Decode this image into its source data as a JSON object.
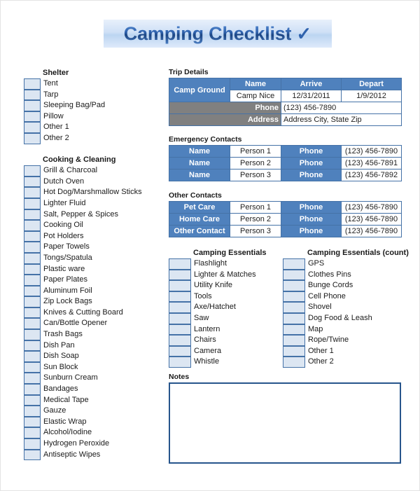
{
  "title": {
    "text": "Camping Checklist",
    "check_icon": "✓",
    "accent": "#2f62ad",
    "banner_bg": "#cfe0f6"
  },
  "left_sections": [
    {
      "heading": "Shelter",
      "items": [
        "Tent",
        "Tarp",
        "Sleeping Bag/Pad",
        "Pillow",
        "Other 1",
        "Other 2"
      ]
    },
    {
      "heading": "Cooking & Cleaning",
      "items": [
        "Grill & Charcoal",
        "Dutch Oven",
        "Hot Dog/Marshmallow Sticks",
        "Lighter Fluid",
        "Salt, Pepper & Spices",
        "Cooking Oil",
        "Pot Holders",
        "Paper Towels",
        "Tongs/Spatula",
        "Plastic ware",
        "Paper Plates",
        "Aluminum Foil",
        "Zip Lock Bags",
        "Knives & Cutting Board",
        "Can/Bottle Opener",
        "Trash Bags",
        "Dish Pan",
        "Dish Soap",
        "Sun Block",
        "Sunburn Cream",
        "Bandages",
        "Medical Tape",
        "Gauze",
        "Elastic Wrap",
        "Alcohol/Iodine",
        "Hydrogen Peroxide",
        "Antiseptic Wipes"
      ]
    }
  ],
  "trip_details": {
    "heading": "Trip Details",
    "row_label": "Camp Ground",
    "columns": [
      "Name",
      "Arrive",
      "Depart"
    ],
    "values": [
      "Camp Nice",
      "12/31/2011",
      "1/9/2012"
    ],
    "phone_label": "Phone",
    "phone_value": "(123) 456-7890",
    "address_label": "Address",
    "address_value": "Address City, State Zip"
  },
  "emergency_contacts": {
    "heading": "Emergency Contacts",
    "rows": [
      {
        "label": "Name",
        "person": "Person 1",
        "phone_label": "Phone",
        "phone": "(123) 456-7890"
      },
      {
        "label": "Name",
        "person": "Person 2",
        "phone_label": "Phone",
        "phone": "(123) 456-7891"
      },
      {
        "label": "Name",
        "person": "Person 3",
        "phone_label": "Phone",
        "phone": "(123) 456-7892"
      }
    ]
  },
  "other_contacts": {
    "heading": "Other Contacts",
    "rows": [
      {
        "label": "Pet Care",
        "person": "Person 1",
        "phone_label": "Phone",
        "phone": "(123) 456-7890"
      },
      {
        "label": "Home Care",
        "person": "Person 2",
        "phone_label": "Phone",
        "phone": "(123) 456-7890"
      },
      {
        "label": "Other Contact",
        "person": "Person 3",
        "phone_label": "Phone",
        "phone": "(123) 456-7890"
      }
    ]
  },
  "essentials_left": {
    "heading": "Camping Essentials",
    "items": [
      "Flashlight",
      "Lighter & Matches",
      "Utility Knife",
      "Tools",
      "Axe/Hatchet",
      "Saw",
      "Lantern",
      "Chairs",
      "Camera",
      "Whistle"
    ]
  },
  "essentials_right": {
    "heading": "Camping Essentials (count)",
    "items": [
      "GPS",
      "Clothes Pins",
      "Bunge Cords",
      "Cell Phone",
      "Shovel",
      "Dog Food & Leash",
      "Map",
      "Rope/Twine",
      "Other 1",
      "Other 2"
    ]
  },
  "notes": {
    "heading": "Notes",
    "value": ""
  }
}
